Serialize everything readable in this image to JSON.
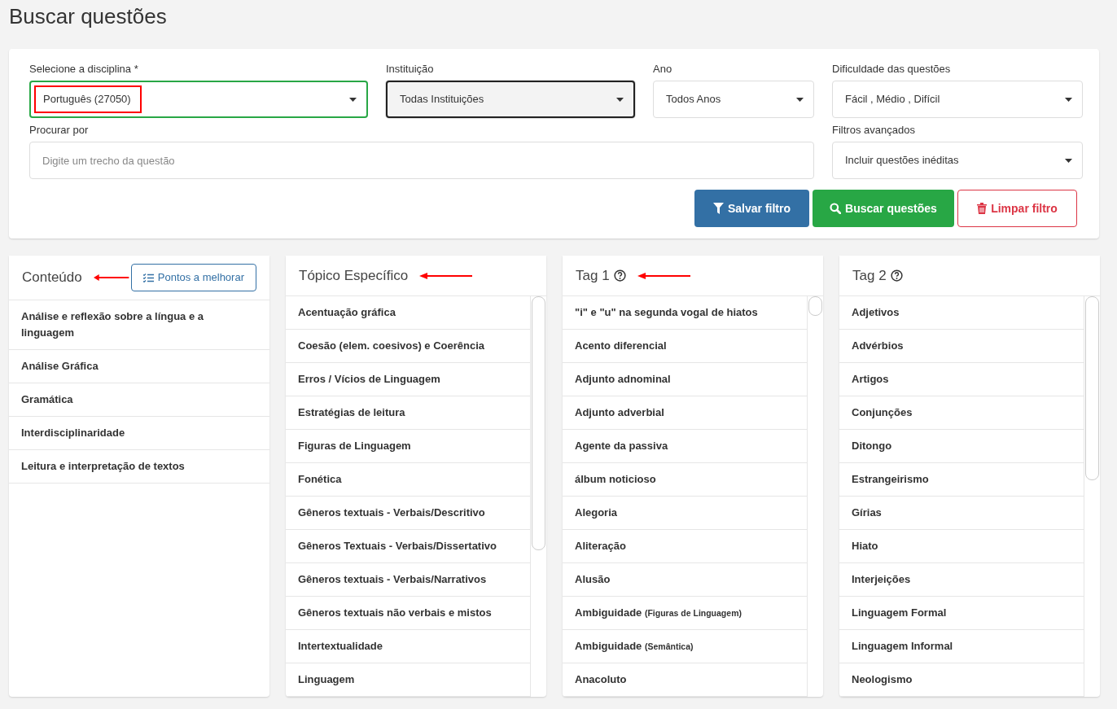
{
  "page_title": "Buscar questões",
  "filters": {
    "fields": [
      {
        "kind": "select",
        "label": "Selecione a disciplina *",
        "value": "Português (27050)",
        "valid": true,
        "focused": false,
        "highlighted": true
      },
      {
        "kind": "select",
        "label": "Instituição",
        "value": "Todas Instituições",
        "valid": false,
        "focused": true,
        "highlighted": false
      },
      {
        "kind": "select",
        "label": "Ano",
        "value": "Todos Anos",
        "valid": false,
        "focused": false,
        "highlighted": false
      },
      {
        "kind": "select",
        "label": "Dificuldade das questões",
        "value": "Fácil , Médio , Difícil",
        "valid": false,
        "focused": false,
        "highlighted": false
      },
      {
        "kind": "text",
        "label": "Procurar por",
        "placeholder": "Digite um trecho da questão",
        "valid": false,
        "focused": false,
        "highlighted": false
      },
      {
        "kind": "select",
        "label": "Filtros avançados",
        "value": "Incluir questões inéditas",
        "valid": false,
        "focused": false,
        "highlighted": false
      }
    ],
    "buttons": [
      {
        "kind": "save",
        "label": "Salvar filtro"
      },
      {
        "kind": "search",
        "label": "Buscar questões"
      },
      {
        "kind": "clear",
        "label": "Limpar filtro"
      }
    ]
  },
  "panels": [
    {
      "title": "Conteúdo",
      "help": false,
      "arrow": true,
      "action": "Pontos a melhorar",
      "scrollbar": false,
      "items": [
        {
          "label": "Análise e reflexão sobre a língua e a linguagem"
        },
        {
          "label": "Análise Gráfica"
        },
        {
          "label": "Gramática"
        },
        {
          "label": "Interdisciplinaridade"
        },
        {
          "label": "Leitura e interpretação de textos"
        }
      ]
    },
    {
      "title": "Tópico Específico",
      "help": false,
      "arrow": true,
      "scrollbar": true,
      "items": [
        {
          "label": "Acentuação gráfica"
        },
        {
          "label": "Coesão (elem. coesivos) e Coerência"
        },
        {
          "label": "Erros / Vícios de Linguagem"
        },
        {
          "label": "Estratégias de leitura"
        },
        {
          "label": "Figuras de Linguagem"
        },
        {
          "label": "Fonética"
        },
        {
          "label": "Gêneros textuais - Verbais/Descritivo"
        },
        {
          "label": "Gêneros Textuais - Verbais/Dissertativo"
        },
        {
          "label": "Gêneros textuais - Verbais/Narrativos"
        },
        {
          "label": "Gêneros textuais não verbais e mistos"
        },
        {
          "label": "Intertextualidade"
        },
        {
          "label": "Linguagem"
        }
      ]
    },
    {
      "title": "Tag 1",
      "help": true,
      "arrow": true,
      "scrollbar": true,
      "items": [
        {
          "label": "\"i\" e \"u\" na segunda vogal de hiatos"
        },
        {
          "label": "Acento diferencial"
        },
        {
          "label": "Adjunto adnominal"
        },
        {
          "label": "Adjunto adverbial"
        },
        {
          "label": "Agente da passiva"
        },
        {
          "label": "álbum noticioso"
        },
        {
          "label": "Alegoria"
        },
        {
          "label": "Aliteração"
        },
        {
          "label": "Alusão"
        },
        {
          "label": "Ambiguidade",
          "note": "(Figuras de Linguagem)"
        },
        {
          "label": "Ambiguidade",
          "note": "(Semântica)"
        },
        {
          "label": "Anacoluto"
        }
      ]
    },
    {
      "title": "Tag 2",
      "help": true,
      "arrow": false,
      "scrollbar": true,
      "items": [
        {
          "label": "Adjetivos"
        },
        {
          "label": "Advérbios"
        },
        {
          "label": "Artigos"
        },
        {
          "label": "Conjunções"
        },
        {
          "label": "Ditongo"
        },
        {
          "label": "Estrangeirismo"
        },
        {
          "label": "Gírias"
        },
        {
          "label": "Hiato"
        },
        {
          "label": "Interjeições"
        },
        {
          "label": "Linguagem Formal"
        },
        {
          "label": "Linguagem Informal"
        },
        {
          "label": "Neologismo"
        }
      ]
    }
  ]
}
